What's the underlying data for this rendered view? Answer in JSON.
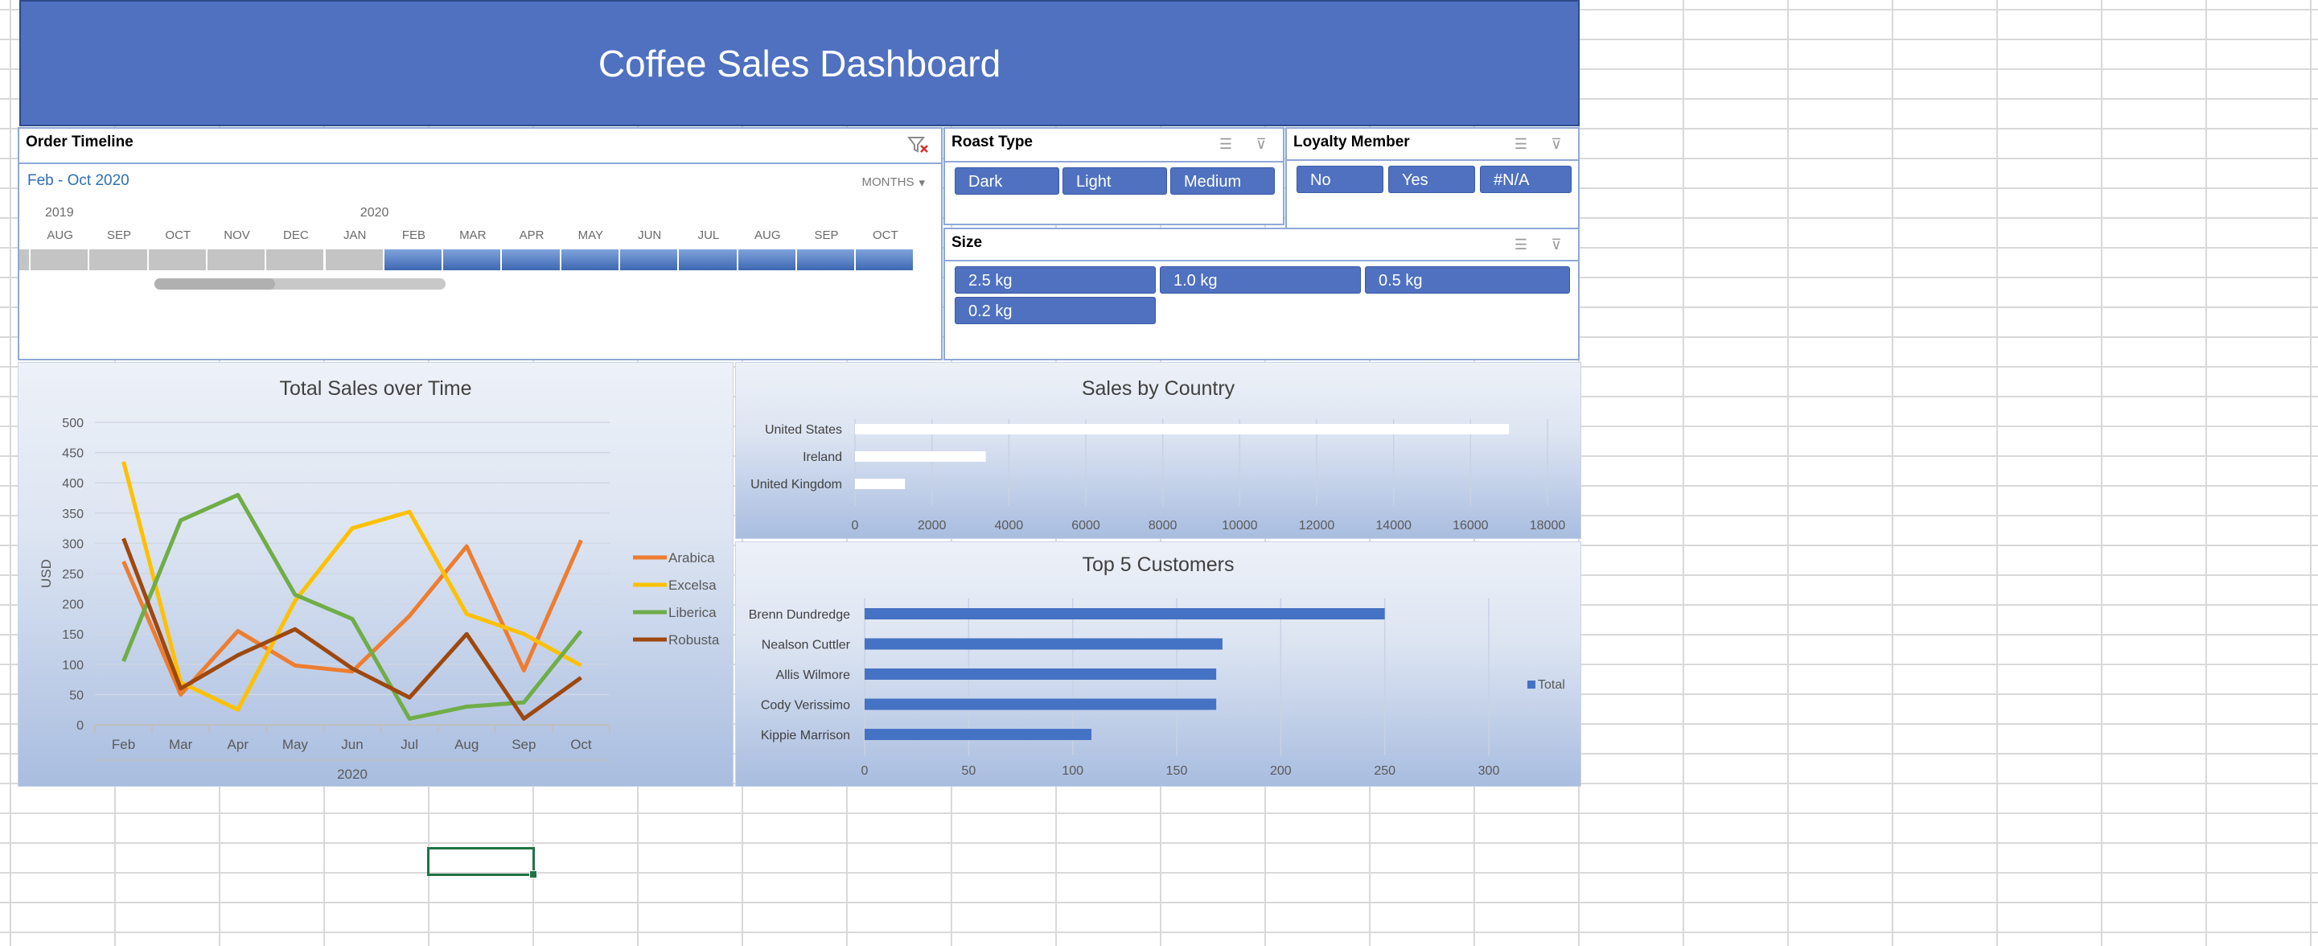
{
  "dashboard": {
    "title": "Coffee Sales Dashboard"
  },
  "timeline": {
    "title": "Order Timeline",
    "range_label": "Feb - Oct 2020",
    "units_label": "MONTHS",
    "years": [
      "2019",
      "2020"
    ],
    "months": [
      "AUG",
      "SEP",
      "OCT",
      "NOV",
      "DEC",
      "JAN",
      "FEB",
      "MAR",
      "APR",
      "MAY",
      "JUN",
      "JUL",
      "AUG",
      "SEP",
      "OCT"
    ],
    "selected_from_index": 6,
    "selected_to_index": 14
  },
  "roast_type": {
    "title": "Roast Type",
    "items": [
      "Dark",
      "Light",
      "Medium"
    ]
  },
  "loyalty": {
    "title": "Loyalty Member",
    "items": [
      "No",
      "Yes",
      "#N/A"
    ]
  },
  "size": {
    "title": "Size",
    "items": [
      "2.5 kg",
      "1.0 kg",
      "0.5 kg",
      "0.2 kg"
    ]
  },
  "colors": {
    "arabica": "#ed7d31",
    "excelsa": "#ffc000",
    "liberica": "#70ad47",
    "robusta": "#9e480e",
    "bar_white": "#ffffff",
    "bar_blue": "#4472c4",
    "banner": "#4f71c0"
  },
  "chart_data": [
    {
      "type": "line",
      "title": "Total Sales over Time",
      "categories": [
        "Feb",
        "Mar",
        "Apr",
        "May",
        "Jun",
        "Jul",
        "Aug",
        "Sep",
        "Oct"
      ],
      "xlabel_group": "2020",
      "ylabel": "USD",
      "ylim": [
        0,
        500
      ],
      "yticks": [
        0,
        50,
        100,
        150,
        200,
        250,
        300,
        350,
        400,
        450,
        500
      ],
      "legend_position": "right",
      "series": [
        {
          "name": "Arabica",
          "color": "#ed7d31",
          "values": [
            270,
            50,
            155,
            98,
            88,
            180,
            295,
            90,
            305
          ]
        },
        {
          "name": "Excelsa",
          "color": "#ffc000",
          "values": [
            435,
            70,
            25,
            205,
            325,
            352,
            183,
            150,
            98
          ]
        },
        {
          "name": "Liberica",
          "color": "#70ad47",
          "values": [
            105,
            338,
            380,
            215,
            175,
            10,
            30,
            37,
            155
          ]
        },
        {
          "name": "Robusta",
          "color": "#9e480e",
          "values": [
            308,
            60,
            115,
            158,
            93,
            45,
            150,
            10,
            78
          ]
        }
      ]
    },
    {
      "type": "bar",
      "orientation": "horizontal",
      "title": "Sales by Country",
      "categories": [
        "United States",
        "Ireland",
        "United Kingdom"
      ],
      "values": [
        17000,
        3400,
        1300
      ],
      "xlim": [
        0,
        18000
      ],
      "xticks": [
        0,
        2000,
        4000,
        6000,
        8000,
        10000,
        12000,
        14000,
        16000,
        18000
      ]
    },
    {
      "type": "bar",
      "orientation": "horizontal",
      "title": "Top 5 Customers",
      "categories": [
        "Brenn Dundredge",
        "Nealson Cuttler",
        "Allis Wilmore",
        "Cody Verissimo",
        "Kippie Marrison"
      ],
      "series": [
        {
          "name": "Total",
          "values": [
            250,
            172,
            169,
            169,
            109
          ]
        }
      ],
      "xlim": [
        0,
        300
      ],
      "xticks": [
        0,
        50,
        100,
        150,
        200,
        250,
        300
      ],
      "legend_position": "right"
    }
  ]
}
